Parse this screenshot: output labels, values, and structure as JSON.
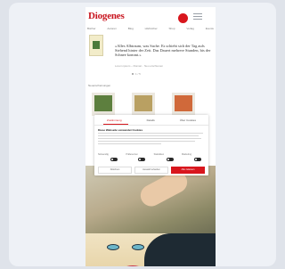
{
  "header": {
    "logo_text": "Diogenes",
    "brand_color": "#c8141e",
    "nav": [
      "Bücher",
      "Autoren",
      "Blog",
      "Hörbücher",
      "Shop",
      "Verlag",
      "Events"
    ]
  },
  "feature": {
    "headline": "«Alles Albtraum, was Sache. Es schiebt sich der Tag aufs Stehend hinter der Zeit. Das Dauert mehrere Stunden, bis der Schnee kommt.»",
    "subline": "Lorem ipsum – Roman · Neu erschienen",
    "pager_label": "1 / 5"
  },
  "new_releases": {
    "label": "Neuerscheinungen"
  },
  "cookie": {
    "tabs": [
      "Zustimmung",
      "Details",
      "Über Cookies"
    ],
    "title": "Diese Webseite verwendet Cookies",
    "toggles": [
      "Notwendig",
      "Präferenzen",
      "Statistiken",
      "Marketing"
    ],
    "buttons": [
      "Ablehnen",
      "Auswahl erlauben",
      "Alle zulassen"
    ]
  }
}
